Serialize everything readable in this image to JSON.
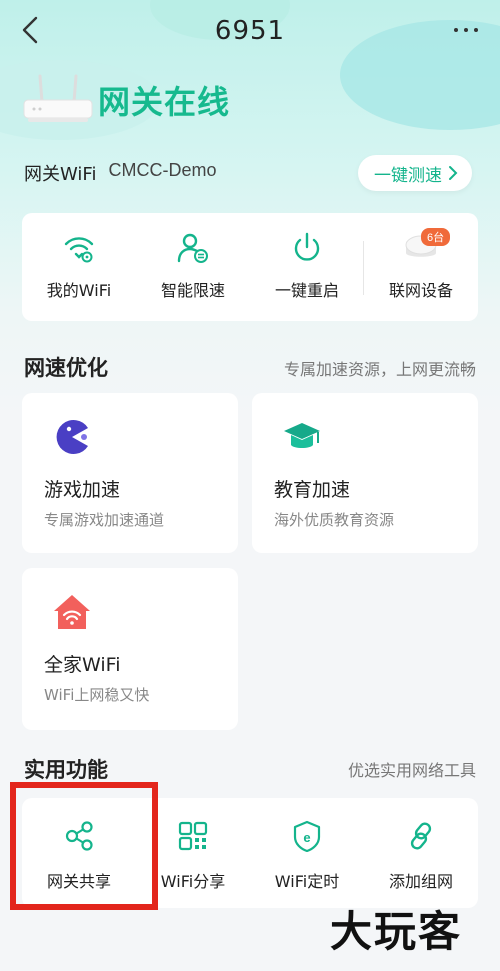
{
  "header": {
    "title": "6951"
  },
  "gateway": {
    "status": "网关在线",
    "wifi_label": "网关WiFi",
    "wifi_ssid": "CMCC-Demo",
    "speedtest_label": "一键测速"
  },
  "quick_actions": [
    {
      "label": "我的WiFi",
      "icon": "wifi-settings-icon"
    },
    {
      "label": "智能限速",
      "icon": "user-speed-limit-icon"
    },
    {
      "label": "一键重启",
      "icon": "power-icon"
    },
    {
      "label": "联网设备",
      "icon": "connected-devices-icon",
      "badge": "6台"
    }
  ],
  "speed_opt": {
    "title": "网速优化",
    "subtitle": "专属加速资源，上网更流畅",
    "cards": [
      {
        "title": "游戏加速",
        "sub": "专属游戏加速通道",
        "icon": "game-pacman-icon"
      },
      {
        "title": "教育加速",
        "sub": "海外优质教育资源",
        "icon": "graduation-cap-icon"
      },
      {
        "title": "全家WiFi",
        "sub": "WiFi上网稳又快",
        "icon": "home-wifi-icon"
      }
    ]
  },
  "tools": {
    "title": "实用功能",
    "subtitle": "优选实用网络工具",
    "items": [
      {
        "label": "网关共享",
        "icon": "share-icon"
      },
      {
        "label": "WiFi分享",
        "icon": "qr-code-icon"
      },
      {
        "label": "WiFi定时",
        "icon": "timer-e-icon"
      },
      {
        "label": "添加组网",
        "icon": "link-icon"
      }
    ]
  },
  "watermark": "大玩客",
  "colors": {
    "accent": "#16b98e",
    "highlight": "#e3261c",
    "badge": "#f06a3a"
  }
}
